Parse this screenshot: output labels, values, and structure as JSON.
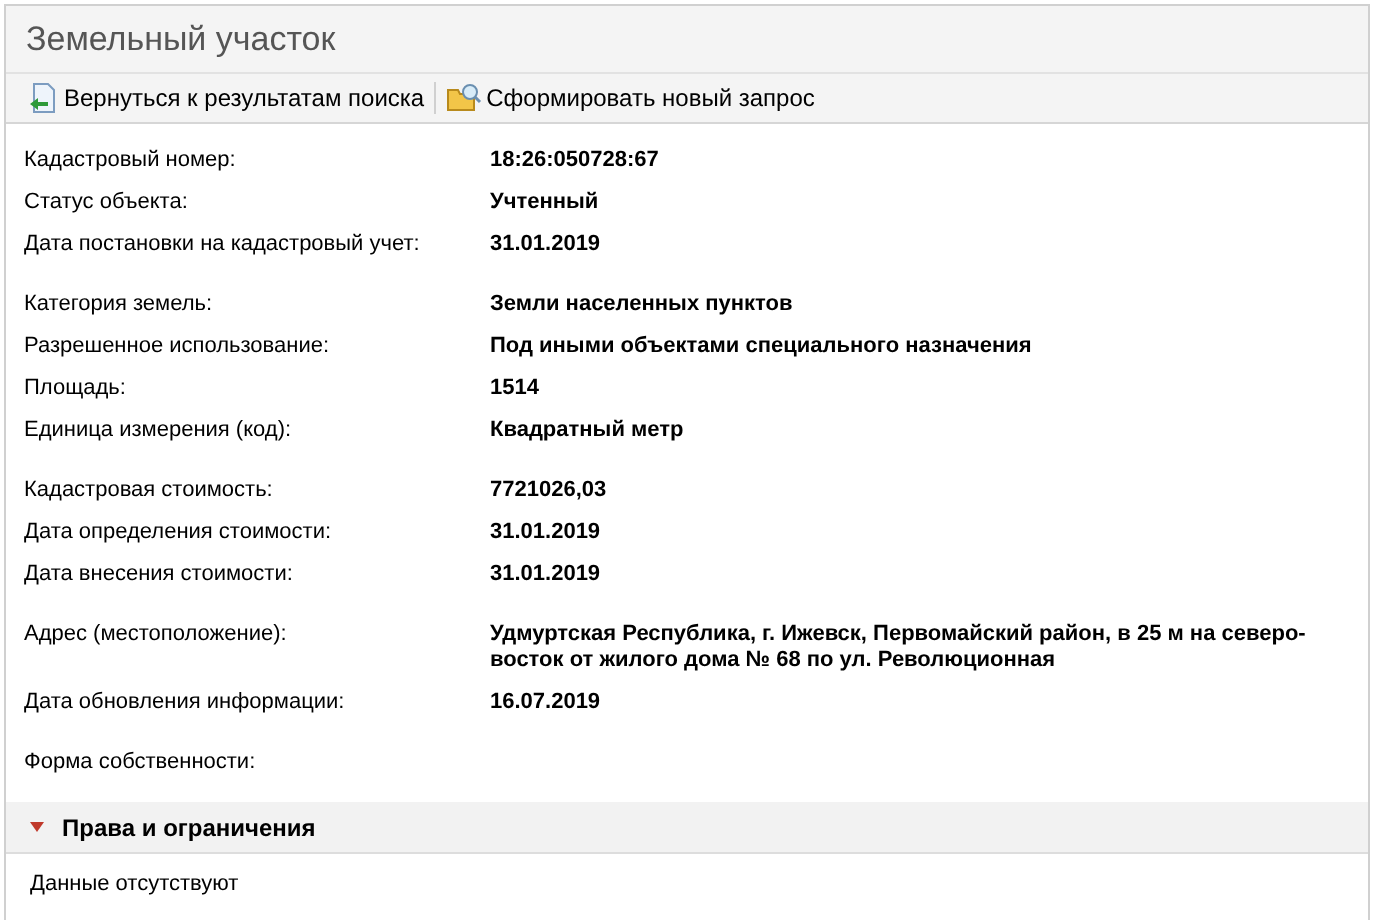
{
  "title": "Земельный участок",
  "toolbar": [
    {
      "kind": "back",
      "label": "Вернуться к результатам поиска"
    },
    {
      "kind": "new",
      "label": "Сформировать новый запрос"
    }
  ],
  "groups": [
    [
      {
        "label": "Кадастровый номер:",
        "value": "18:26:050728:67"
      },
      {
        "label": "Статус объекта:",
        "value": "Учтенный"
      },
      {
        "label": "Дата постановки на кадастровый учет:",
        "value": "31.01.2019"
      }
    ],
    [
      {
        "label": "Категория земель:",
        "value": "Земли населенных пунктов"
      },
      {
        "label": "Разрешенное использование:",
        "value": "Под иными объектами специального назначения"
      },
      {
        "label": "Площадь:",
        "value": "1514"
      },
      {
        "label": "Единица измерения (код):",
        "value": "Квадратный метр"
      }
    ],
    [
      {
        "label": "Кадастровая стоимость:",
        "value": "7721026,03"
      },
      {
        "label": "Дата определения стоимости:",
        "value": "31.01.2019"
      },
      {
        "label": "Дата внесения стоимости:",
        "value": "31.01.2019"
      }
    ],
    [
      {
        "label": "Адрес (местоположение):",
        "value": "Удмуртская Республика, г. Ижевск, Первомайский район, в 25 м на северо-восток от жилого дома № 68 по ул. Революционная"
      },
      {
        "label": "Дата обновления информации:",
        "value": "16.07.2019"
      }
    ],
    [
      {
        "label": "Форма собственности:"
      }
    ]
  ],
  "section": {
    "title": "Права и ограничения",
    "expanded": true,
    "text": "Данные отсутствуют"
  }
}
